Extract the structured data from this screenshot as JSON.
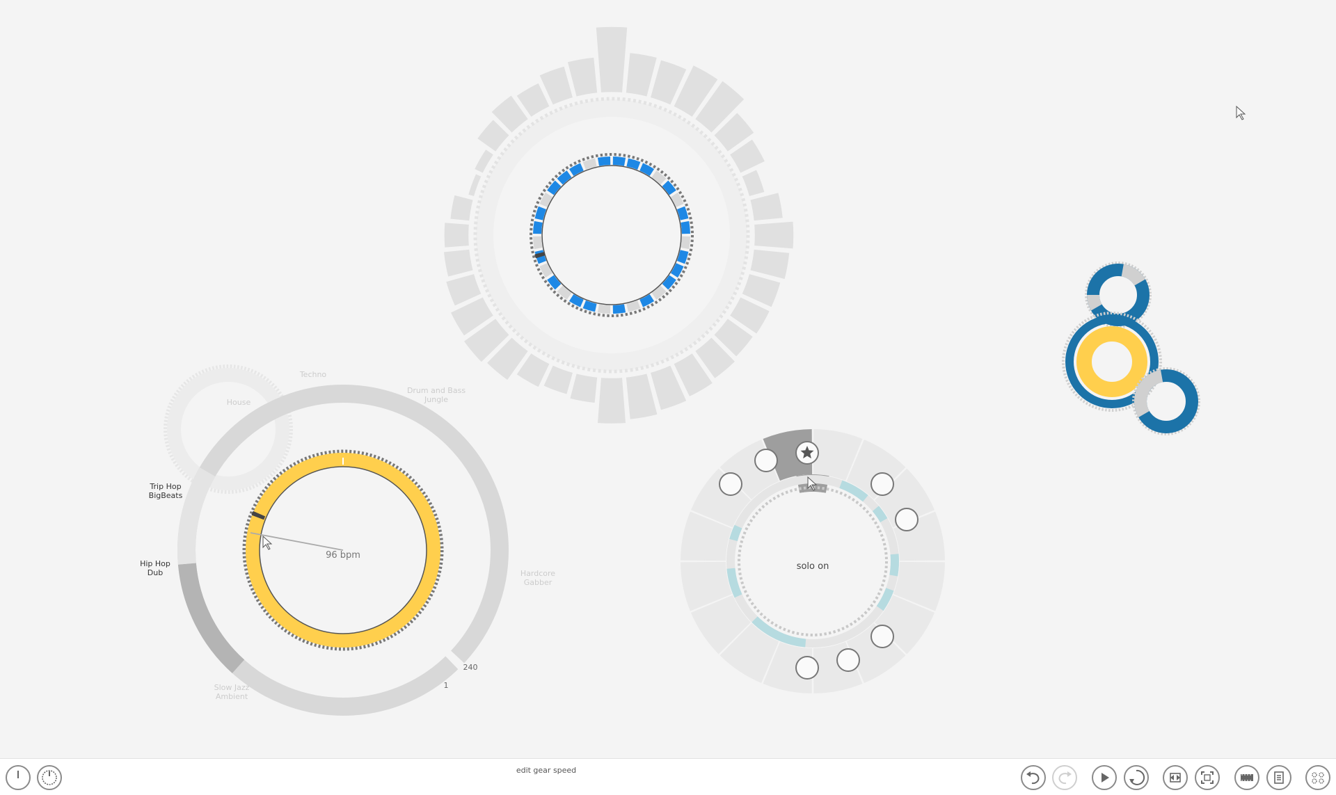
{
  "speed_gear": {
    "bpm_label": "96 bpm",
    "bpm": 96,
    "min_label": "1",
    "max_label": "240",
    "min": 1,
    "max": 240,
    "genres": [
      {
        "name": "Slow Jazz\nAmbient",
        "active": false
      },
      {
        "name": "Hip Hop\nDub",
        "active": true
      },
      {
        "name": "Trip Hop\nBigBeats",
        "active": true
      },
      {
        "name": "House",
        "active": false
      },
      {
        "name": "Techno",
        "active": false
      },
      {
        "name": "Drum and Bass\nJungle",
        "active": false
      },
      {
        "name": "Hardcore\nGabber",
        "active": false
      }
    ]
  },
  "pie_menu": {
    "center_label": "solo on",
    "items": [
      {
        "icon": "star-icon",
        "active": true
      },
      {
        "icon": "trash-icon",
        "active": false
      },
      {
        "icon": "duplicate-icon",
        "active": false
      },
      {
        "icon": "rotate-gear-icon",
        "active": false
      },
      {
        "icon": "dashed-circle-icon",
        "active": false
      },
      {
        "icon": "clock-icon",
        "active": false
      },
      {
        "icon": "volume-bars-icon",
        "active": false
      },
      {
        "icon": "speaker-icon",
        "active": false
      }
    ]
  },
  "status": {
    "text": "edit gear speed"
  },
  "toolbar": {
    "left": [
      {
        "name": "power-button",
        "icon": "power-icon"
      },
      {
        "name": "timer-button",
        "icon": "timer-icon"
      }
    ],
    "right": [
      {
        "name": "undo-button",
        "icon": "undo-icon",
        "enabled": true
      },
      {
        "name": "redo-button",
        "icon": "redo-icon",
        "enabled": false
      },
      {
        "name": "play-button",
        "icon": "play-icon",
        "enabled": true
      },
      {
        "name": "loop-button",
        "icon": "loop-icon",
        "enabled": true
      },
      {
        "name": "fit-view-button",
        "icon": "fit-view-icon",
        "enabled": true
      },
      {
        "name": "fullscreen-button",
        "icon": "fullscreen-icon",
        "enabled": true
      },
      {
        "name": "filmstrip-button",
        "icon": "filmstrip-icon",
        "enabled": true
      },
      {
        "name": "notes-button",
        "icon": "notes-icon",
        "enabled": true
      },
      {
        "name": "gear-grid-button",
        "icon": "gear-grid-icon",
        "enabled": true
      }
    ]
  },
  "colors": {
    "background": "#f4f4f4",
    "yellow": "#ffcf4d",
    "blue": "#1e88e5",
    "dark_blue": "#1c73a8",
    "teal": "#b6dbe0",
    "gray_light": "#e6e6e6",
    "gray_mid": "#d4d4d4",
    "gray_dark": "#a6a6a6",
    "pie_active": "#9e9e9e"
  }
}
